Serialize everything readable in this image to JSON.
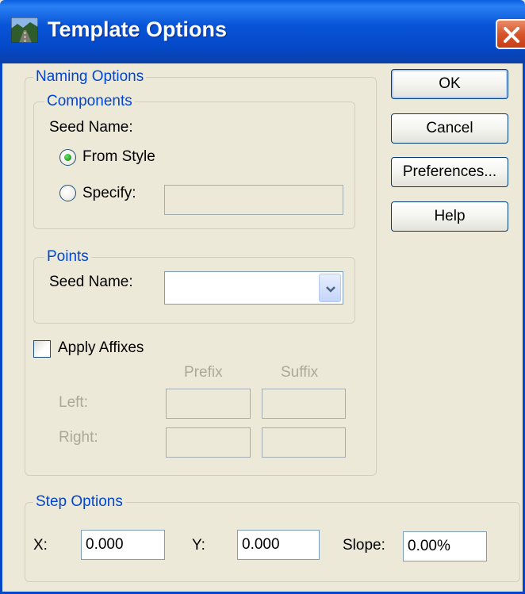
{
  "window": {
    "title": "Template Options",
    "title_icon": "road-template-icon",
    "close_icon": "close-icon"
  },
  "naming_options": {
    "legend": "Naming Options",
    "components": {
      "legend": "Components",
      "seed_name_label": "Seed Name:",
      "from_style_label": "From Style",
      "from_style_selected": true,
      "specify_label": "Specify:",
      "specify_selected": false,
      "specify_value": ""
    },
    "points": {
      "legend": "Points",
      "seed_name_label": "Seed Name:",
      "seed_name_value": ""
    },
    "affixes": {
      "apply_label": "Apply Affixes",
      "checked": false,
      "prefix_header": "Prefix",
      "suffix_header": "Suffix",
      "left_label": "Left:",
      "right_label": "Right:",
      "left_prefix": "",
      "left_suffix": "",
      "right_prefix": "",
      "right_suffix": ""
    }
  },
  "step_options": {
    "legend": "Step Options",
    "x_label": "X:",
    "x_value": "0.000",
    "y_label": "Y:",
    "y_value": "0.000",
    "slope_label": "Slope:",
    "slope_value": "0.00%"
  },
  "buttons": {
    "ok": "OK",
    "cancel": "Cancel",
    "preferences": "Preferences...",
    "help": "Help"
  },
  "colors": {
    "titlebar": "#0A5FE0",
    "group_legend": "#0046D5",
    "dialog_bg": "#ECE9D8",
    "close_button": "#D8562C"
  }
}
